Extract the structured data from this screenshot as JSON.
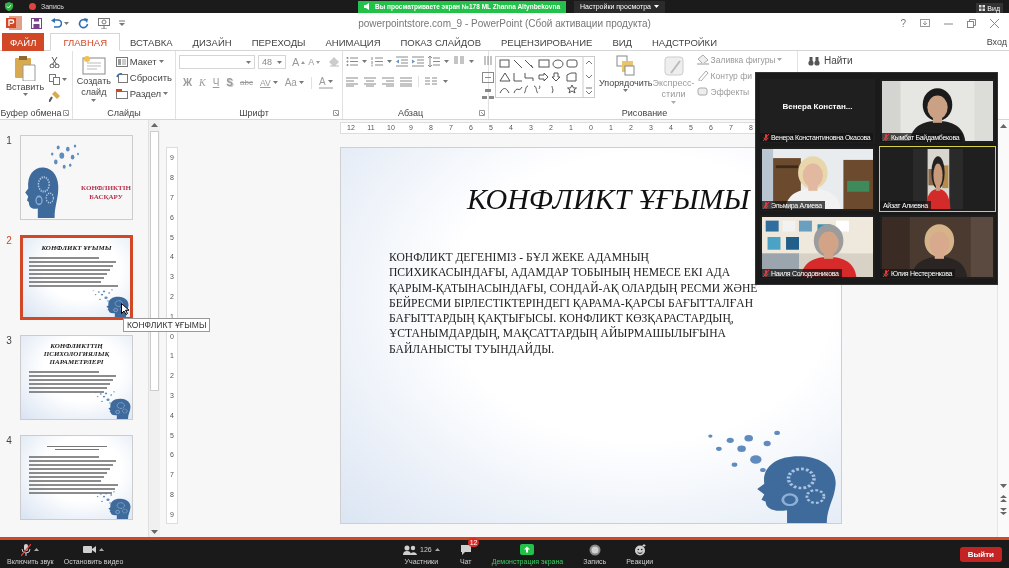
{
  "zoom_top": {
    "recording": "Запись",
    "banner": "Вы просматриваете экран №178 ML Zhanna Altynbekovna",
    "view_options": "Настройки просмотра",
    "view": "Вид"
  },
  "window": {
    "title": "powerpointstore.com_9 - PowerPoint (Сбой активации продукта)",
    "help": "?"
  },
  "tabs": [
    {
      "label": "ФАЙЛ",
      "kind": "file",
      "selected": false
    },
    {
      "label": "ГЛАВНАЯ",
      "kind": "tab",
      "selected": true
    },
    {
      "label": "ВСТАВКА",
      "kind": "tab",
      "selected": false
    },
    {
      "label": "ДИЗАЙН",
      "kind": "tab",
      "selected": false
    },
    {
      "label": "ПЕРЕХОДЫ",
      "kind": "tab",
      "selected": false
    },
    {
      "label": "АНИМАЦИЯ",
      "kind": "tab",
      "selected": false
    },
    {
      "label": "ПОКАЗ СЛАЙДОВ",
      "kind": "tab",
      "selected": false
    },
    {
      "label": "РЕЦЕНЗИРОВАНИЕ",
      "kind": "tab",
      "selected": false
    },
    {
      "label": "ВИД",
      "kind": "tab",
      "selected": false
    },
    {
      "label": "НАДСТРОЙКИ",
      "kind": "tab",
      "selected": false
    }
  ],
  "sign_in": "Вход",
  "ribbon": {
    "clipboard": {
      "paste": "Вставить",
      "label": "Буфер обмена"
    },
    "slides": {
      "new_slide": "Создать слайд",
      "layout": "Макет",
      "reset": "Сбросить",
      "section": "Раздел",
      "label": "Слайды"
    },
    "font": {
      "size": "48",
      "grow": "A",
      "shrink": "A",
      "formats": [
        {
          "label": "Ж",
          "kind": "bold"
        },
        {
          "label": "К",
          "kind": "italic"
        },
        {
          "label": "Ч",
          "kind": "underline"
        },
        {
          "label": "S",
          "kind": "shadow"
        },
        {
          "label": "abc",
          "kind": "strike"
        },
        {
          "label": "AV",
          "kind": "spacing"
        },
        {
          "label": "Aa",
          "kind": "case"
        }
      ],
      "text_color_button": "A",
      "label": "Шрифт"
    },
    "paragraph": {
      "label": "Абзац"
    },
    "drawing": {
      "arrange": "Упорядочить",
      "quick_styles": "Экспресс-стили",
      "fill": "Заливка фигуры",
      "outline": "Контур фи",
      "effects": "Эффекты",
      "label": "Рисование"
    },
    "editing": {
      "find": "Найти"
    }
  },
  "slides": [
    {
      "number": "1",
      "kind": "title",
      "selected": false,
      "title": "КОНФЛИКТІН БАСҚАРУ"
    },
    {
      "number": "2",
      "kind": "content",
      "selected": true,
      "title": "КОНФЛИКТ ҰҒЫМЫ"
    },
    {
      "number": "3",
      "kind": "content",
      "selected": false,
      "title": "КОНФЛИКТТІҢ ПСИХОЛОГИЯЛЫҚ ПАРАМЕТРЛЕРІ"
    },
    {
      "number": "4",
      "kind": "content",
      "selected": false
    }
  ],
  "tooltip": "КОНФЛИКТ ҰҒЫМЫ",
  "rulers": {
    "horizontal": [
      "12",
      "11",
      "10",
      "9",
      "8",
      "7",
      "6",
      "5",
      "4",
      "3",
      "2",
      "1",
      "0",
      "1",
      "2",
      "3",
      "4",
      "5",
      "6",
      "7",
      "8"
    ],
    "vertical": [
      "9",
      "8",
      "7",
      "6",
      "5",
      "4",
      "3",
      "2",
      "1",
      "0",
      "1",
      "2",
      "3",
      "4",
      "5",
      "6",
      "7",
      "8",
      "9"
    ]
  },
  "slide": {
    "title": "КОНФЛИКТ ҰҒЫМЫ",
    "body_lines": [
      "КОНФЛИКТ ДЕГЕНІМІЗ - БҰЛ ЖЕКЕ АДАМНЫҢ",
      "ПСИХИКАСЫНДАҒЫ, АДАМДАР ТОБЫНЫҢ НЕМЕСЕ ЕКІ АДА",
      "ҚАРЫМ-ҚАТЫНАСЫНДАҒЫ, СОНДАЙ-АҚ ОЛАРДЫҢ РЕСМИ ЖӘНЕ",
      "БЕЙРЕСМИ БІРЛЕСТІКТЕРІНДЕГІ ҚАРАМА-ҚАРСЫ БАҒЫТТАЛҒАН",
      "БАҒЫТТАРДЫҢ ҚАҚТЫҒЫСЫ. КОНФЛИКТ КӨЗҚАРАСТАРДЫҢ,",
      "ҰСТАНЫМДАРДЫҢ, МАҚСАТТАРДЫҢ АЙЫРМАШЫЛЫҒЫНА",
      "БАЙЛАНЫСТЫ ТУЫНДАЙДЫ."
    ]
  },
  "video_tiles": [
    {
      "kind": "name",
      "display_name": "Венера Констан...",
      "label": "Венера Константиновна Окасова",
      "muted": true,
      "active": false
    },
    {
      "kind": "video",
      "label": "Кымбат Байдамбекова",
      "muted": true,
      "active": false
    },
    {
      "kind": "video",
      "label": "Эльмира Алиева",
      "muted": true,
      "active": false
    },
    {
      "kind": "portrait",
      "label": "Айзат Алиевна",
      "muted": false,
      "active": true
    },
    {
      "kind": "video",
      "label": "Наиля Солодовникова",
      "muted": true,
      "active": false
    },
    {
      "kind": "video",
      "label": "Юлия Нестеренкова",
      "muted": true,
      "active": false
    }
  ],
  "zoom_bar": {
    "controls": [
      {
        "kind": "mic",
        "label": "Включить звук",
        "muted": true
      },
      {
        "kind": "video",
        "label": "Остановить видео"
      }
    ],
    "center": [
      {
        "kind": "participants",
        "label": "Участники",
        "count": "126"
      },
      {
        "kind": "chat",
        "label": "Чат",
        "badge": "12"
      },
      {
        "kind": "share",
        "label": "Демонстрация экрана"
      },
      {
        "kind": "record",
        "label": "Запись"
      },
      {
        "kind": "reactions",
        "label": "Реакции"
      }
    ],
    "leave": "Выйти"
  }
}
